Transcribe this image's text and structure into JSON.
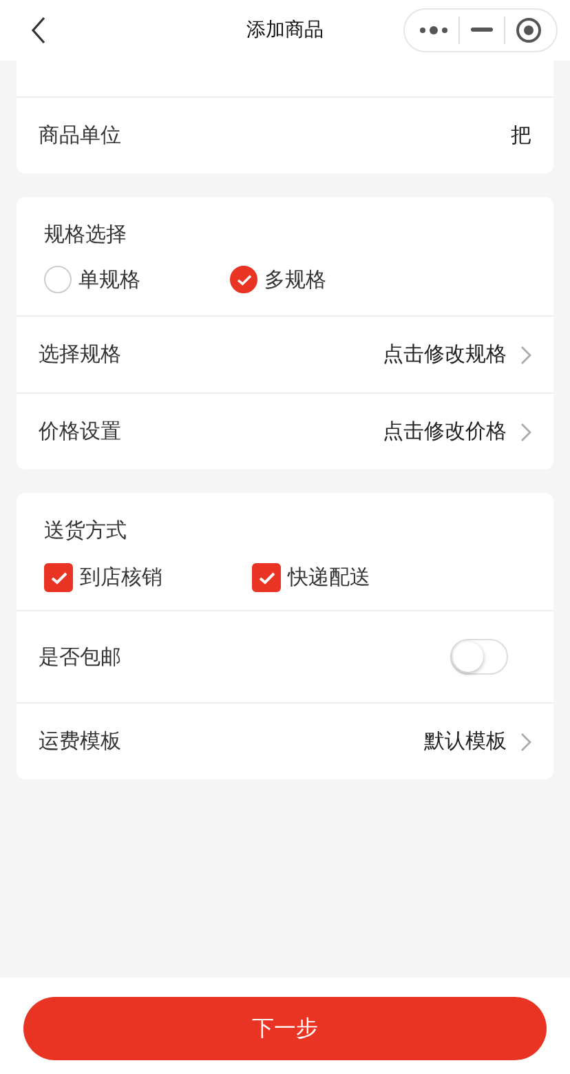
{
  "nav": {
    "title": "添加商品"
  },
  "basic": {
    "rows": [
      {
        "kind": "text",
        "label": "商品单位",
        "value": "把"
      }
    ]
  },
  "spec": {
    "title": "规格选择",
    "options": [
      {
        "label": "单规格",
        "selected": false
      },
      {
        "label": "多规格",
        "selected": true
      }
    ],
    "rows": [
      {
        "kind": "link",
        "label": "选择规格",
        "value": "点击修改规格"
      },
      {
        "kind": "link",
        "label": "价格设置",
        "value": "点击修改价格"
      }
    ]
  },
  "delivery": {
    "title": "送货方式",
    "methods": [
      {
        "label": "到店核销",
        "checked": true
      },
      {
        "label": "快递配送",
        "checked": true
      }
    ],
    "rows": [
      {
        "kind": "switch",
        "label": "是否包邮",
        "on": false
      },
      {
        "kind": "link",
        "label": "运费模板",
        "value": "默认模板"
      }
    ]
  },
  "next_button": "下一步"
}
